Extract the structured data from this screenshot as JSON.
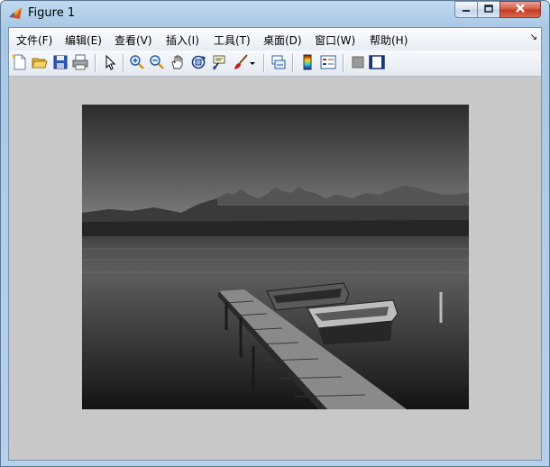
{
  "window": {
    "title": "Figure 1",
    "controls": {
      "minimize": "minimize-icon",
      "maximize": "maximize-icon",
      "close": "close-icon"
    }
  },
  "menu": {
    "items": [
      {
        "label": "文件(F)"
      },
      {
        "label": "编辑(E)"
      },
      {
        "label": "查看(V)"
      },
      {
        "label": "插入(I)"
      },
      {
        "label": "工具(T)"
      },
      {
        "label": "桌面(D)"
      },
      {
        "label": "窗口(W)"
      },
      {
        "label": "帮助(H)"
      }
    ],
    "overflow_arrow": "↘"
  },
  "toolbar": {
    "icons": [
      "new-figure-icon",
      "open-file-icon",
      "save-icon",
      "print-icon",
      "edit-plot-arrow-icon",
      "zoom-in-icon",
      "zoom-out-icon",
      "pan-hand-icon",
      "rotate-3d-icon",
      "data-cursor-icon",
      "brush-icon",
      "brush-dropdown-icon",
      "link-plot-icon",
      "insert-colorbar-icon",
      "insert-legend-icon",
      "hide-plot-tools-icon",
      "show-plot-tools-icon"
    ]
  },
  "figure": {
    "content": "grayscale photograph of a wooden pier with two rowboats on a calm lake with mountains"
  }
}
